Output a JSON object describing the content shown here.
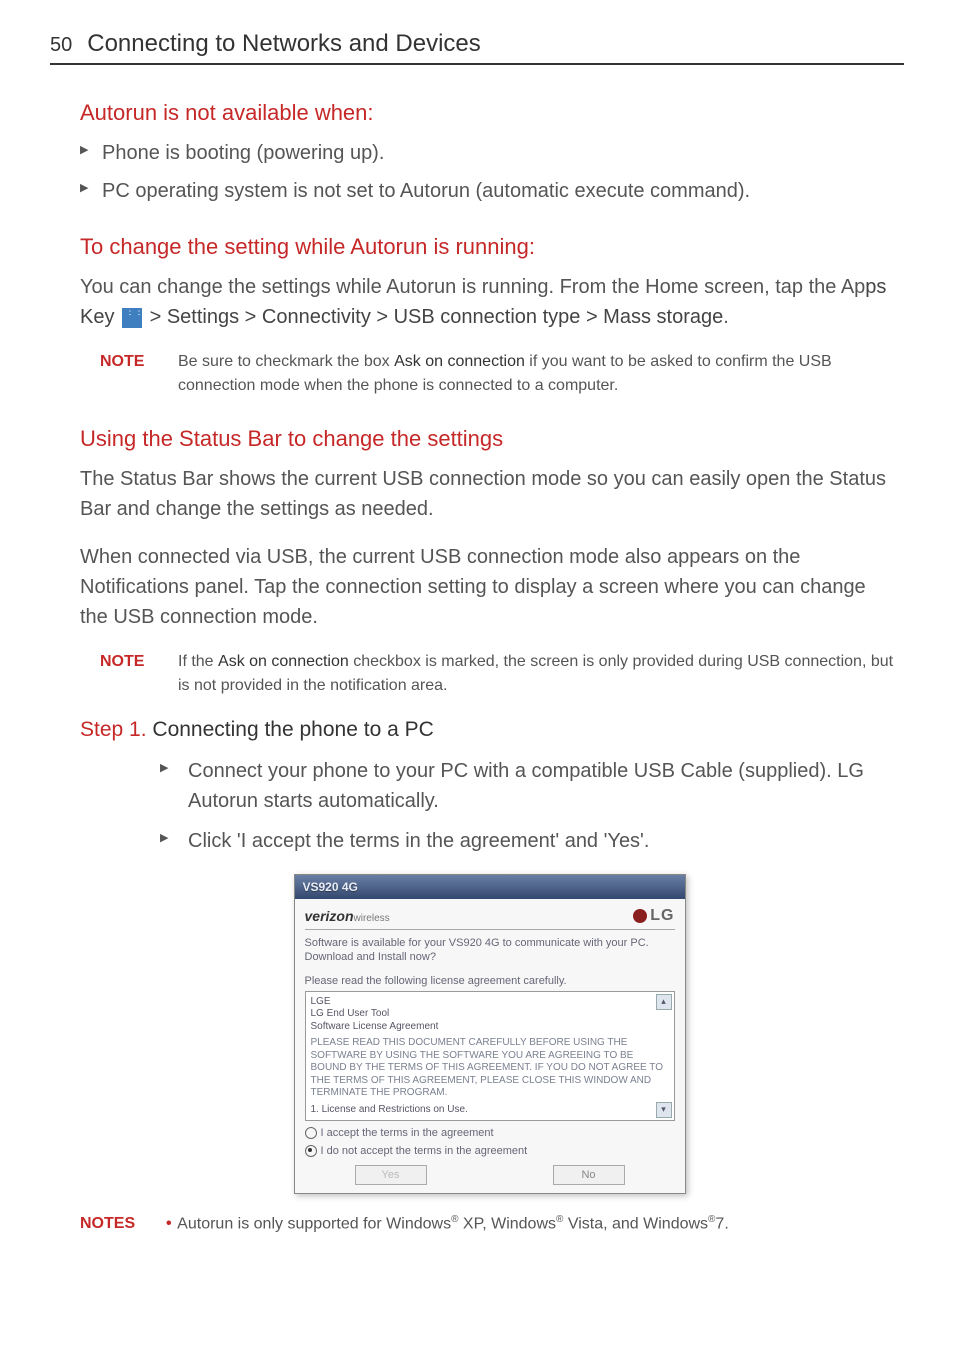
{
  "header": {
    "page_number": "50",
    "title": "Connecting to Networks and Devices"
  },
  "sec1": {
    "heading": "Autorun is not available when:",
    "items": [
      "Phone is booting (powering up).",
      "PC operating system is not set to Autorun (automatic execute command)."
    ]
  },
  "sec2": {
    "heading": "To change the setting while Autorun is running:",
    "body_pre": "You can change the settings while Autorun is running. From the Home screen, tap the Ap",
    "body_bold1": "ps Key ",
    "body_bold2": " > Settings > Connectivity > USB connection type > Mass storage",
    "body_post": "."
  },
  "note1": {
    "label": "NOTE",
    "text_pre": "Be sure to checkmark the box ",
    "bold": "Ask on connection",
    "text_post": " if you want to be asked to confirm the USB connection mode when the phone is connected to a computer."
  },
  "sec3": {
    "heading": "Using the Status Bar to change the settings",
    "p1": "The Status Bar shows the current USB connection mode so you can easily open the Status Bar and change the settings as needed.",
    "p2": "When connected via USB, the current USB connection mode also appears on the Notifications panel. Tap the connection setting to display a screen where you can change the USB connection mode."
  },
  "note2": {
    "label": "NOTE",
    "text_pre": "If the ",
    "bold": "Ask on connection",
    "text_post": " checkbox is marked, the screen is only provided during USB connection, but is not provided in the notification area."
  },
  "step1": {
    "prefix": "Step 1.",
    "title": " Connecting the phone to a PC",
    "items": [
      "Connect your phone to your PC with a compatible USB Cable (supplied). LG Autorun starts automatically.",
      "Click 'I accept the terms in the agreement' and 'Yes'."
    ]
  },
  "dialog": {
    "titlebar": "VS920 4G",
    "brand_vz": "verizon",
    "brand_vz_sub": "wireless",
    "brand_lg": "LG",
    "msg": "Software is available for your VS920 4G to communicate with your PC. Download and Install now?",
    "inst": "Please read the following license agreement carefully.",
    "lic_head1": "LGE",
    "lic_head2": "LG End User Tool",
    "lic_head3": "Software License Agreement",
    "lic_body": "PLEASE READ THIS DOCUMENT CAREFULLY BEFORE USING THE SOFTWARE BY USING THE SOFTWARE YOU ARE AGREEING TO BE BOUND BY THE TERMS OF THIS AGREEMENT. IF YOU DO NOT AGREE TO THE TERMS OF THIS AGREEMENT, PLEASE CLOSE THIS WINDOW AND TERMINATE THE PROGRAM.",
    "lic_item1": "1. License and Restrictions on Use.",
    "radio_accept": "I accept the terms in the agreement",
    "radio_decline": "I do not accept the terms in the agreement",
    "btn_yes": "Yes",
    "btn_no": "No"
  },
  "notes_bottom": {
    "label": "NOTES",
    "text_pre": "Autorun is only supported for Windows",
    "reg": "®",
    "t1": " XP, Windows",
    "t2": " Vista, and Windows",
    "t3": "7."
  }
}
